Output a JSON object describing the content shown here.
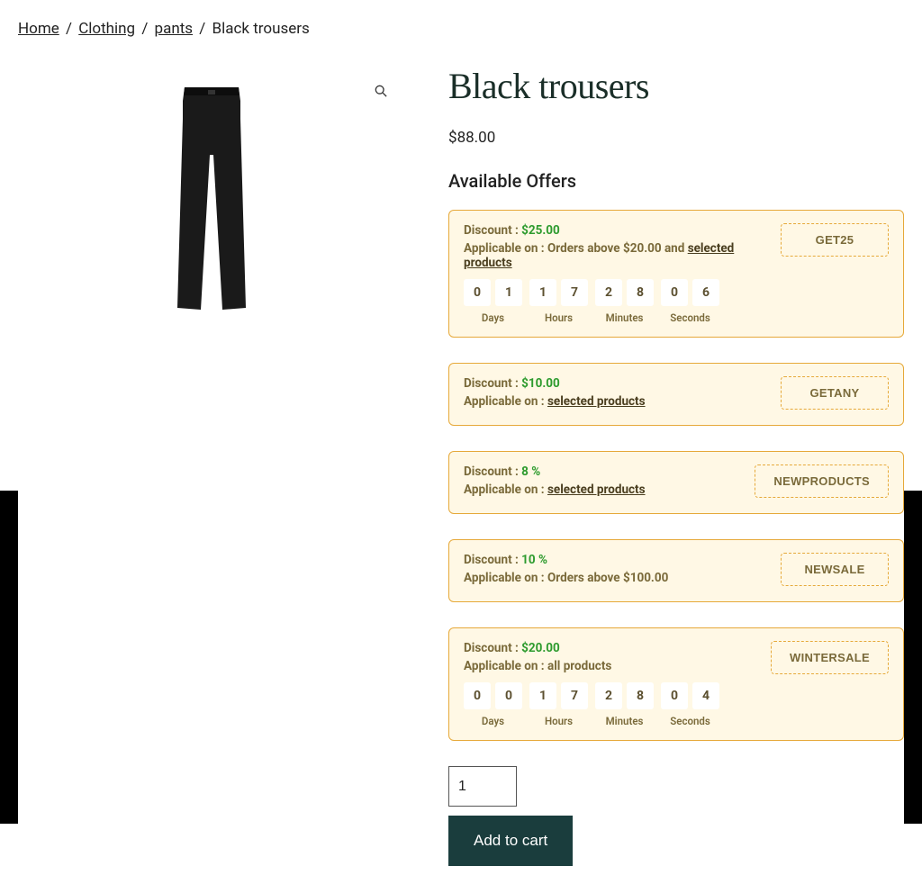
{
  "breadcrumb": {
    "home": "Home",
    "clothing": "Clothing",
    "pants": "pants",
    "current": "Black trousers"
  },
  "product": {
    "title": "Black trousers",
    "currency": "$",
    "price": "88.00",
    "qty": "1",
    "add_to_cart_label": "Add to cart"
  },
  "offers_heading": "Available Offers",
  "labels": {
    "discount": "Discount : ",
    "applicable": "Applicable on : ",
    "selected_products": "selected products",
    "days": "Days",
    "hours": "Hours",
    "minutes": "Minutes",
    "seconds": "Seconds"
  },
  "offers": [
    {
      "discount_value": "$25.00",
      "applicable_prefix": "Orders above $20.00 and ",
      "applicable_link": "selected products",
      "applicable_suffix": "",
      "code": "GET25",
      "countdown": {
        "d": [
          "0",
          "1"
        ],
        "h": [
          "1",
          "7"
        ],
        "m": [
          "2",
          "8"
        ],
        "s": [
          "0",
          "6"
        ]
      }
    },
    {
      "discount_value": "$10.00",
      "applicable_prefix": "",
      "applicable_link": "selected products",
      "applicable_suffix": "",
      "code": "GETANY",
      "countdown": null
    },
    {
      "discount_value": "8 %",
      "applicable_prefix": "",
      "applicable_link": "selected products",
      "applicable_suffix": "",
      "code": "NEWPRODUCTS",
      "countdown": null
    },
    {
      "discount_value": "10 %",
      "applicable_prefix": "Orders above $100.00",
      "applicable_link": "",
      "applicable_suffix": "",
      "code": "NEWSALE",
      "countdown": null
    },
    {
      "discount_value": "$20.00",
      "applicable_prefix": "all products",
      "applicable_link": "",
      "applicable_suffix": "",
      "code": "WINTERSALE",
      "countdown": {
        "d": [
          "0",
          "0"
        ],
        "h": [
          "1",
          "7"
        ],
        "m": [
          "2",
          "8"
        ],
        "s": [
          "0",
          "4"
        ]
      }
    }
  ]
}
